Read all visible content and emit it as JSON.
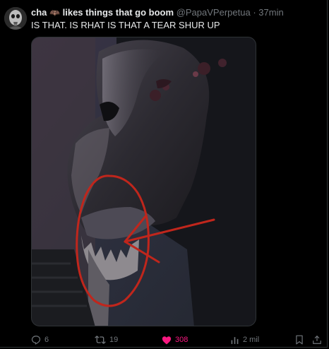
{
  "tweet": {
    "display_name": "cha",
    "name_emoji": "🦇",
    "name_suffix": "likes things that go boom",
    "handle": "@PapaVPerpetua",
    "separator": "·",
    "timestamp": "37min",
    "text": "IS THAT. IS RHAT IS THAT A TEAR SHUR UP"
  },
  "actions": {
    "replies": "6",
    "retweets": "19",
    "likes": "308",
    "views": "2 mil"
  },
  "colors": {
    "background": "#000000",
    "text": "#e7e9ea",
    "muted": "#71767b",
    "like_pink": "#f91880",
    "annotation_red": "#c0261c"
  },
  "icons": {
    "reply": "speech-bubble-icon",
    "retweet": "retweet-arrows-icon",
    "like": "heart-filled-icon",
    "views": "bar-chart-icon",
    "bookmark": "bookmark-icon",
    "share": "share-upload-icon"
  }
}
